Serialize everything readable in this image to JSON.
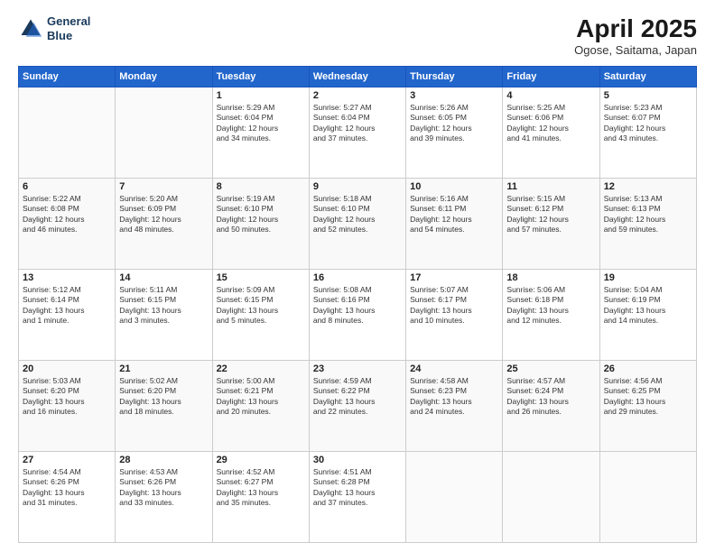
{
  "header": {
    "logo_line1": "General",
    "logo_line2": "Blue",
    "month": "April 2025",
    "location": "Ogose, Saitama, Japan"
  },
  "weekdays": [
    "Sunday",
    "Monday",
    "Tuesday",
    "Wednesday",
    "Thursday",
    "Friday",
    "Saturday"
  ],
  "weeks": [
    [
      {
        "day": "",
        "info": ""
      },
      {
        "day": "",
        "info": ""
      },
      {
        "day": "1",
        "info": "Sunrise: 5:29 AM\nSunset: 6:04 PM\nDaylight: 12 hours\nand 34 minutes."
      },
      {
        "day": "2",
        "info": "Sunrise: 5:27 AM\nSunset: 6:04 PM\nDaylight: 12 hours\nand 37 minutes."
      },
      {
        "day": "3",
        "info": "Sunrise: 5:26 AM\nSunset: 6:05 PM\nDaylight: 12 hours\nand 39 minutes."
      },
      {
        "day": "4",
        "info": "Sunrise: 5:25 AM\nSunset: 6:06 PM\nDaylight: 12 hours\nand 41 minutes."
      },
      {
        "day": "5",
        "info": "Sunrise: 5:23 AM\nSunset: 6:07 PM\nDaylight: 12 hours\nand 43 minutes."
      }
    ],
    [
      {
        "day": "6",
        "info": "Sunrise: 5:22 AM\nSunset: 6:08 PM\nDaylight: 12 hours\nand 46 minutes."
      },
      {
        "day": "7",
        "info": "Sunrise: 5:20 AM\nSunset: 6:09 PM\nDaylight: 12 hours\nand 48 minutes."
      },
      {
        "day": "8",
        "info": "Sunrise: 5:19 AM\nSunset: 6:10 PM\nDaylight: 12 hours\nand 50 minutes."
      },
      {
        "day": "9",
        "info": "Sunrise: 5:18 AM\nSunset: 6:10 PM\nDaylight: 12 hours\nand 52 minutes."
      },
      {
        "day": "10",
        "info": "Sunrise: 5:16 AM\nSunset: 6:11 PM\nDaylight: 12 hours\nand 54 minutes."
      },
      {
        "day": "11",
        "info": "Sunrise: 5:15 AM\nSunset: 6:12 PM\nDaylight: 12 hours\nand 57 minutes."
      },
      {
        "day": "12",
        "info": "Sunrise: 5:13 AM\nSunset: 6:13 PM\nDaylight: 12 hours\nand 59 minutes."
      }
    ],
    [
      {
        "day": "13",
        "info": "Sunrise: 5:12 AM\nSunset: 6:14 PM\nDaylight: 13 hours\nand 1 minute."
      },
      {
        "day": "14",
        "info": "Sunrise: 5:11 AM\nSunset: 6:15 PM\nDaylight: 13 hours\nand 3 minutes."
      },
      {
        "day": "15",
        "info": "Sunrise: 5:09 AM\nSunset: 6:15 PM\nDaylight: 13 hours\nand 5 minutes."
      },
      {
        "day": "16",
        "info": "Sunrise: 5:08 AM\nSunset: 6:16 PM\nDaylight: 13 hours\nand 8 minutes."
      },
      {
        "day": "17",
        "info": "Sunrise: 5:07 AM\nSunset: 6:17 PM\nDaylight: 13 hours\nand 10 minutes."
      },
      {
        "day": "18",
        "info": "Sunrise: 5:06 AM\nSunset: 6:18 PM\nDaylight: 13 hours\nand 12 minutes."
      },
      {
        "day": "19",
        "info": "Sunrise: 5:04 AM\nSunset: 6:19 PM\nDaylight: 13 hours\nand 14 minutes."
      }
    ],
    [
      {
        "day": "20",
        "info": "Sunrise: 5:03 AM\nSunset: 6:20 PM\nDaylight: 13 hours\nand 16 minutes."
      },
      {
        "day": "21",
        "info": "Sunrise: 5:02 AM\nSunset: 6:20 PM\nDaylight: 13 hours\nand 18 minutes."
      },
      {
        "day": "22",
        "info": "Sunrise: 5:00 AM\nSunset: 6:21 PM\nDaylight: 13 hours\nand 20 minutes."
      },
      {
        "day": "23",
        "info": "Sunrise: 4:59 AM\nSunset: 6:22 PM\nDaylight: 13 hours\nand 22 minutes."
      },
      {
        "day": "24",
        "info": "Sunrise: 4:58 AM\nSunset: 6:23 PM\nDaylight: 13 hours\nand 24 minutes."
      },
      {
        "day": "25",
        "info": "Sunrise: 4:57 AM\nSunset: 6:24 PM\nDaylight: 13 hours\nand 26 minutes."
      },
      {
        "day": "26",
        "info": "Sunrise: 4:56 AM\nSunset: 6:25 PM\nDaylight: 13 hours\nand 29 minutes."
      }
    ],
    [
      {
        "day": "27",
        "info": "Sunrise: 4:54 AM\nSunset: 6:26 PM\nDaylight: 13 hours\nand 31 minutes."
      },
      {
        "day": "28",
        "info": "Sunrise: 4:53 AM\nSunset: 6:26 PM\nDaylight: 13 hours\nand 33 minutes."
      },
      {
        "day": "29",
        "info": "Sunrise: 4:52 AM\nSunset: 6:27 PM\nDaylight: 13 hours\nand 35 minutes."
      },
      {
        "day": "30",
        "info": "Sunrise: 4:51 AM\nSunset: 6:28 PM\nDaylight: 13 hours\nand 37 minutes."
      },
      {
        "day": "",
        "info": ""
      },
      {
        "day": "",
        "info": ""
      },
      {
        "day": "",
        "info": ""
      }
    ]
  ]
}
